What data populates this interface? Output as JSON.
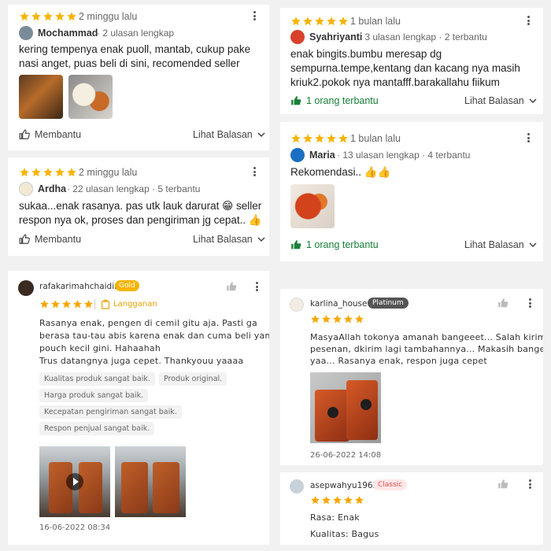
{
  "colors": {
    "google_star": "#f6b400",
    "shopee_star": "#f6a700",
    "green": "#188038"
  },
  "icons": [
    "kebab-menu-icon",
    "thumbs-up-icon",
    "chevron-down-icon",
    "star-icon",
    "like-icon",
    "play-icon",
    "subscription-icon"
  ],
  "reviews": {
    "r1": {
      "rating": 5,
      "time": "2 minggu lalu",
      "name": "Mochammad",
      "meta": "· 2 ulasan lengkap",
      "text_line1": "kering tempenya enak puoll, mantab, cukup pake",
      "text_line2": "nasi anget, puas beli di sini, recomended seller",
      "helpful": "Membantu",
      "replies": "Lihat Balasan"
    },
    "r2": {
      "rating": 5,
      "time": "2 minggu lalu",
      "name": "Ardha",
      "meta": "· 22 ulasan lengkap · 5 terbantu",
      "text_line1": "sukaa...enak rasanya. pas utk lauk darurat 😁 seller",
      "text_line2": "respon nya ok, proses dan pengiriman jg cepat.. 👍",
      "helpful": "Membantu",
      "replies": "Lihat Balasan"
    },
    "r3": {
      "rating": 5,
      "time": "1 bulan lalu",
      "name": "Syahriyanti",
      "meta": "· 3 ulasan lengkap · 2 terbantu",
      "text_line1": "enak bingits.bumbu meresap dg",
      "text_line2": "sempurna.tempe,kentang dan kacang nya masih",
      "text_line3": "kriuk2.pokok nya mantafff.barakallahu fiikum",
      "helpful": "1 orang terbantu",
      "replies": "Lihat Balasan"
    },
    "r4": {
      "rating": 5,
      "time": "1 bulan lalu",
      "name": "Maria",
      "meta": "· 13 ulasan lengkap · 4 terbantu",
      "text_line1": "Rekomendasi.. 👍👍",
      "helpful": "1 orang terbantu",
      "replies": "Lihat Balasan"
    },
    "r5": {
      "rating": 5,
      "name": "rafakarimahchaidir",
      "badge": "Gold",
      "subscription": "Langganan",
      "text_line1": "Rasanya enak, pengen di cemil gitu aja. Pasti ga",
      "text_line2": "berasa tau-tau abis karena enak dan cuma beli yang",
      "text_line3": "pouch kecil gini. Hahaahah",
      "text_line4": "Trus datangnya juga cepet. Thankyouu yaaaa",
      "tags": [
        "Kualitas produk sangat baik.",
        "Produk original.",
        "Harga produk sangat baik.",
        "Kecepatan pengiriman sangat baik.",
        "Respon penjual sangat baik."
      ],
      "date": "16-06-2022 08:34"
    },
    "r6": {
      "rating": 5,
      "name": "karlina_house",
      "badge": "Platinum",
      "text_line1": "MasyaAllah tokonya amanah bangeeet... Salah kirim",
      "text_line2": "pesenan, dkirim lagi tambahannya... Makasih banget",
      "text_line3": "yaa... Rasanya enak, respon juga cepet",
      "date": "26-06-2022 14:08"
    },
    "r7": {
      "rating": 5,
      "name": "asepwahyu1962",
      "badge": "Classic",
      "line1": "Rasa: Enak",
      "line2": "Kualitas: Bagus"
    }
  }
}
